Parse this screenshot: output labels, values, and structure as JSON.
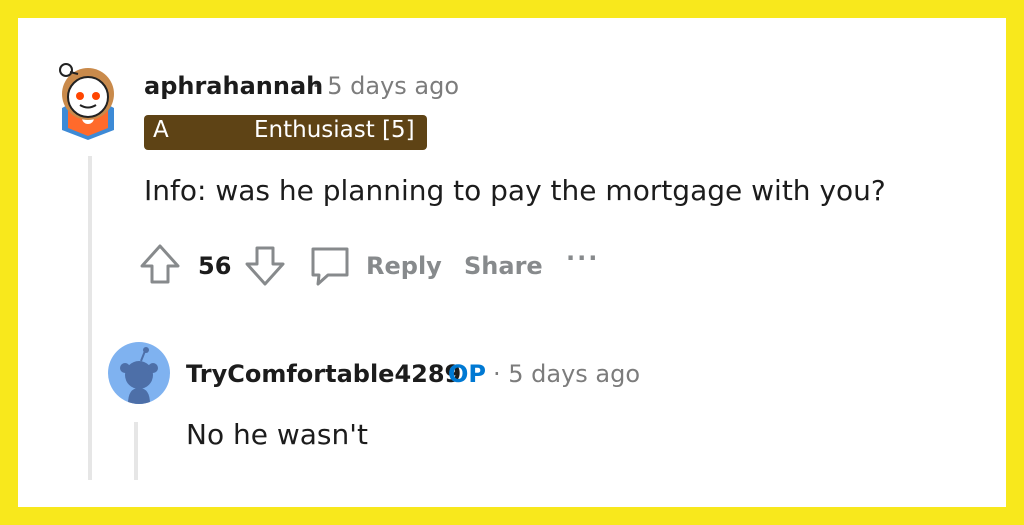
{
  "comment": {
    "username": "aphrahannah",
    "time": "· 5 days ago",
    "flair_prefix": "A",
    "flair_text": "Enthusiast [5]",
    "body": "Info: was he planning to pay the mortgage with you?",
    "score": "56",
    "reply_label": "Reply",
    "share_label": "Share",
    "more_label": "···"
  },
  "reply": {
    "username": "TryComfortable4289",
    "op_badge": "OP",
    "time": "· 5 days ago",
    "body": "No he wasn't"
  },
  "colors": {
    "frame": "#f8e81c",
    "flair_bg": "#5e4315",
    "op": "#0079d3"
  }
}
